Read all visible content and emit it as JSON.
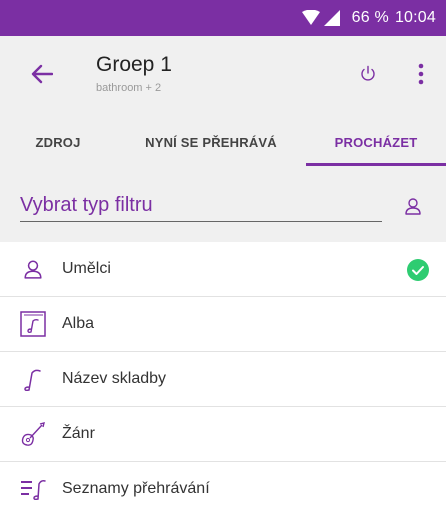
{
  "status_bar": {
    "battery_text": "66 %",
    "time": "10:04",
    "icons": [
      "wifi-icon",
      "signal-icon"
    ]
  },
  "app_bar": {
    "title": "Groep 1",
    "subtitle": "bathroom + 2",
    "icons": [
      "arrow-back-icon",
      "power-icon",
      "more-vert-icon"
    ]
  },
  "tabs": [
    {
      "label": "ZDROJ",
      "selected": false
    },
    {
      "label": "NYNÍ SE PŘEHRÁVÁ",
      "selected": false
    },
    {
      "label": "PROCHÁZET",
      "selected": true
    }
  ],
  "filter": {
    "label": "Vybrat typ filtru",
    "icon": "person-icon"
  },
  "list": {
    "items": [
      {
        "label": "Umělci",
        "icon": "person-icon",
        "selected": true
      },
      {
        "label": "Alba",
        "icon": "album-icon",
        "selected": false
      },
      {
        "label": "Název skladby",
        "icon": "music-note-icon",
        "selected": false
      },
      {
        "label": "Žánr",
        "icon": "guitar-icon",
        "selected": false
      },
      {
        "label": "Seznamy přehrávání",
        "icon": "playlist-icon",
        "selected": false
      }
    ]
  },
  "colors": {
    "accent": "#7b2fa3",
    "check": "#2ecc71",
    "header_bg": "#f0f0f0"
  }
}
